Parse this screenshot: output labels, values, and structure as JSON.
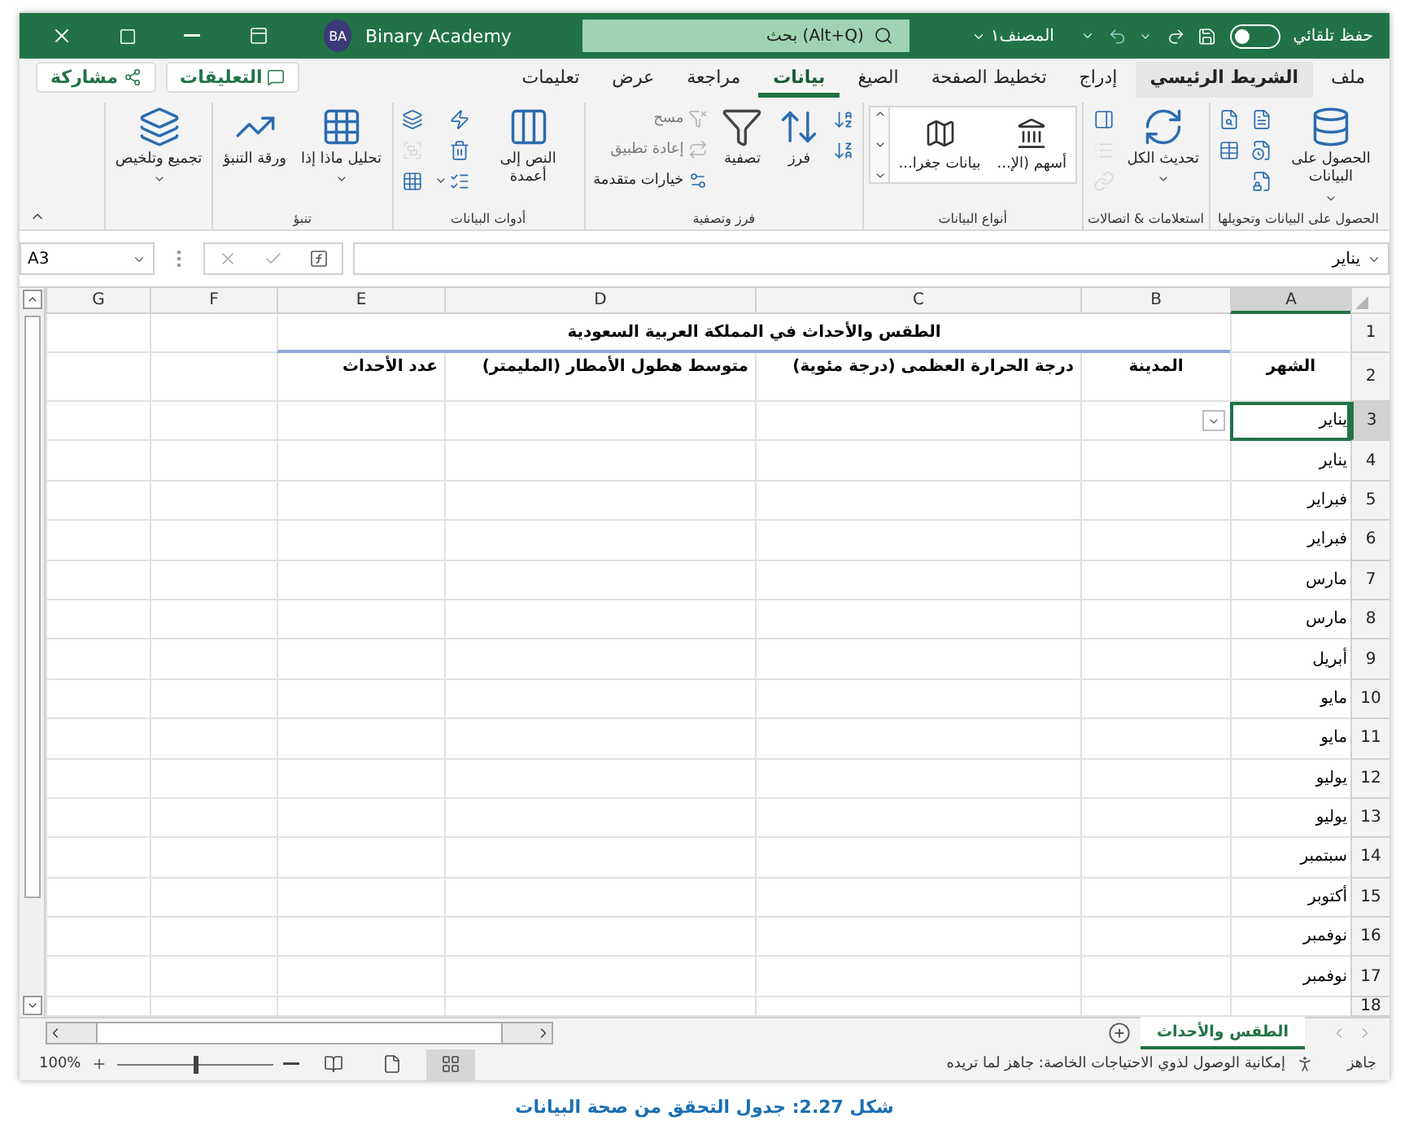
{
  "title_bar": {
    "autosave": {
      "label": "حفظ تلقائي",
      "on": false
    },
    "file_name": "المصنف١",
    "search": {
      "placeholder": "بحث (Alt+Q)"
    },
    "user": {
      "initials": "BA",
      "name": "Binary Academy"
    }
  },
  "ribbon_tabs": [
    {
      "label": "ملف",
      "selected": false,
      "highlighted": false
    },
    {
      "label": "الشريط الرئيسي",
      "selected": false,
      "highlighted": true
    },
    {
      "label": "إدراج",
      "selected": false,
      "highlighted": false
    },
    {
      "label": "تخطيط الصفحة",
      "selected": false,
      "highlighted": false
    },
    {
      "label": "الصيغ",
      "selected": false,
      "highlighted": false
    },
    {
      "label": "بيانات",
      "selected": true,
      "highlighted": false
    },
    {
      "label": "مراجعة",
      "selected": false,
      "highlighted": false
    },
    {
      "label": "عرض",
      "selected": false,
      "highlighted": false
    },
    {
      "label": "تعليمات",
      "selected": false,
      "highlighted": false
    }
  ],
  "ribbon_actions": {
    "comments": "التعليقات",
    "share": "مشاركة"
  },
  "ribbon_groups": [
    {
      "label": "الحصول على البيانات وتحويلها",
      "items": [
        {
          "kind": "large_menu",
          "label": "الحصول على البيانات",
          "disabled": false
        },
        {
          "kind": "icon",
          "disabled": false
        },
        {
          "kind": "icon",
          "disabled": false
        },
        {
          "kind": "icon",
          "disabled": false
        },
        {
          "kind": "icon",
          "disabled": false
        },
        {
          "kind": "icon",
          "disabled": false
        }
      ]
    },
    {
      "label": "استعلامات & اتصالات",
      "items": [
        {
          "kind": "large_menu",
          "label": "تحديث الكل",
          "disabled": false
        },
        {
          "kind": "icon",
          "disabled": false
        },
        {
          "kind": "icon",
          "disabled": true
        },
        {
          "kind": "icon",
          "disabled": true
        }
      ]
    },
    {
      "label": "أنواع البيانات",
      "items": [
        {
          "kind": "gallery",
          "options": [
            "أسهم (الإ...",
            "بيانات جغرا..."
          ]
        }
      ]
    },
    {
      "label": "فرز وتصفية",
      "items": [
        {
          "kind": "icon",
          "disabled": false
        },
        {
          "kind": "icon",
          "disabled": false
        },
        {
          "kind": "large",
          "label": "فرز",
          "disabled": false
        },
        {
          "kind": "large",
          "label": "تصفية",
          "disabled": false
        },
        {
          "kind": "small",
          "label": "مسح",
          "disabled": true
        },
        {
          "kind": "small",
          "label": "إعادة تطبيق",
          "disabled": true
        },
        {
          "kind": "small",
          "label": "خيارات متقدمة",
          "disabled": false
        }
      ]
    },
    {
      "label": "أدوات البيانات",
      "items": [
        {
          "kind": "large",
          "label": "النص إلى أعمدة",
          "disabled": false
        },
        {
          "kind": "icon",
          "disabled": false
        },
        {
          "kind": "icon",
          "disabled": false
        },
        {
          "kind": "icon_menu",
          "disabled": false
        },
        {
          "kind": "icon",
          "disabled": false
        },
        {
          "kind": "icon",
          "disabled": true
        },
        {
          "kind": "icon",
          "disabled": false
        }
      ]
    },
    {
      "label": "تنبؤ",
      "items": [
        {
          "kind": "large_menu",
          "label": "تحليل ماذا إذا",
          "disabled": false
        },
        {
          "kind": "large",
          "label": "ورقة التنبؤ",
          "disabled": false
        }
      ]
    },
    {
      "items": [
        {
          "kind": "large_menu",
          "label": "تجميع وتلخيص",
          "disabled": false
        }
      ]
    }
  ],
  "formula_bar": {
    "name_box": "A3",
    "value": "يناير"
  },
  "sheet": {
    "columns": [
      "A",
      "B",
      "C",
      "D",
      "E",
      "F",
      "G"
    ],
    "title_row": {
      "number": "1",
      "text": "الطقس والأحداث في المملكة العربية السعودية"
    },
    "header_row": {
      "number": "2",
      "cells": [
        "الشهر",
        "المدينة",
        "درجة الحرارة العظمى (درجة مئوية)",
        "متوسط هطول الأمطار (المليمتر)",
        "عدد الأحداث"
      ]
    },
    "data_rows": [
      {
        "number": "3",
        "month": "يناير",
        "selected": true
      },
      {
        "number": "4",
        "month": "يناير",
        "selected": false
      },
      {
        "number": "5",
        "month": "فبراير",
        "selected": false
      },
      {
        "number": "6",
        "month": "فبراير",
        "selected": false
      },
      {
        "number": "7",
        "month": "مارس",
        "selected": false
      },
      {
        "number": "8",
        "month": "مارس",
        "selected": false
      },
      {
        "number": "9",
        "month": "أبريل",
        "selected": false
      },
      {
        "number": "10",
        "month": "مايو",
        "selected": false
      },
      {
        "number": "11",
        "month": "مايو",
        "selected": false
      },
      {
        "number": "12",
        "month": "يوليو",
        "selected": false
      },
      {
        "number": "13",
        "month": "يوليو",
        "selected": false
      },
      {
        "number": "14",
        "month": "سبتمبر",
        "selected": false
      },
      {
        "number": "15",
        "month": "أكتوبر",
        "selected": false
      },
      {
        "number": "16",
        "month": "نوفمبر",
        "selected": false
      },
      {
        "number": "17",
        "month": "نوفمبر",
        "selected": false
      },
      {
        "number": "18",
        "selected": false
      }
    ]
  },
  "sheet_tabs": [
    {
      "label": "الطقس والأحداث",
      "selected": true
    }
  ],
  "status_bar": {
    "mode": "جاهز",
    "accessibility": "إمكانية الوصول لذوي الاحتياجات الخاصة: جاهز لما تريده",
    "zoom": "100%",
    "zoom_slider": {
      "level": 0.5
    },
    "views": [
      {
        "selected": true
      },
      {
        "selected": false
      },
      {
        "selected": false
      }
    ]
  },
  "caption": "شكل 2.27: جدول التحقق من صحة البيانات"
}
